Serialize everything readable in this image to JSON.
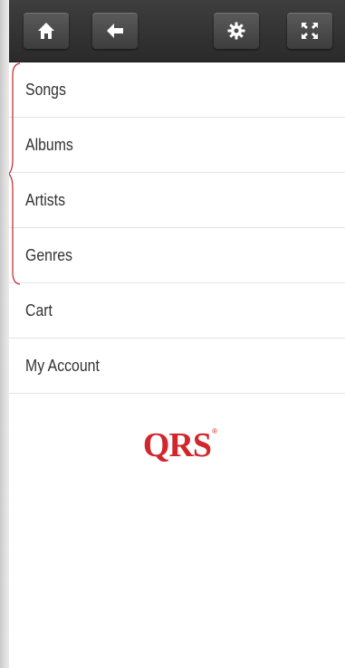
{
  "toolbar": {
    "buttons": [
      {
        "icon": "home-icon"
      },
      {
        "icon": "back-arrow-icon"
      },
      {
        "icon": "gear-icon"
      },
      {
        "icon": "fullscreen-icon"
      }
    ]
  },
  "menu": {
    "items": [
      {
        "label": "Songs"
      },
      {
        "label": "Albums"
      },
      {
        "label": "Artists"
      },
      {
        "label": "Genres"
      },
      {
        "label": "Cart"
      },
      {
        "label": "My Account"
      }
    ],
    "browse_brace_color": "#c0232a"
  },
  "logo": {
    "text": "QRS",
    "mark": "®",
    "color": "#d0262c"
  }
}
